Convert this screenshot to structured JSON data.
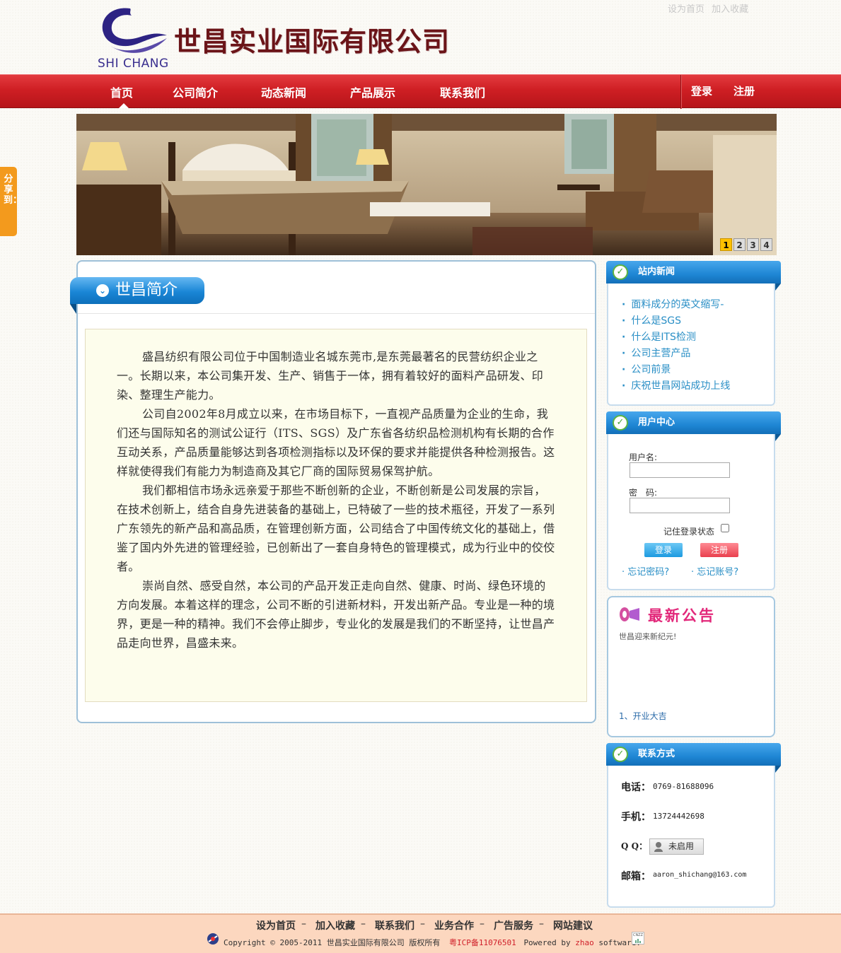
{
  "colors": {
    "nav_red": "#cf1f24",
    "brand_blue": "#1a86d6",
    "link_blue": "#2a8fc6",
    "share_orange": "#f39a1d",
    "notice_pink": "#e2287a"
  },
  "top_links": [
    "设为首页",
    "加入收藏"
  ],
  "header": {
    "company_name": "世昌实业国际有限公司",
    "logo_text": "SHI CHANG"
  },
  "nav": {
    "items": [
      "首页",
      "公司简介",
      "动态新闻",
      "产品展示",
      "联系我们"
    ],
    "login": "登录",
    "register": "注册"
  },
  "share": {
    "label": "分享到："
  },
  "banner": {
    "dots": [
      "1",
      "2",
      "3",
      "4"
    ],
    "active_dot": "1"
  },
  "intro": {
    "title": "世昌简介",
    "paragraphs": [
      "盛昌纺织有限公司位于中国制造业名城东莞市,是东莞最著名的民营纺织企业之一。长期以来，本公司集开发、生产、销售于一体，拥有着较好的面料产品研发、印染、整理生产能力。",
      "公司自2002年8月成立以来，在市场目标下，一直视产品质量为企业的生命，我们还与国际知名的测试公证行（ITS、SGS）及广东省各纺织品检测机构有长期的合作互动关系，产品质量能够达到各项检测指标以及环保的要求并能提供各种检测报告。这样就使得我们有能力为制造商及其它厂商的国际贸易保驾护航。",
      "我们都相信市场永远亲爱于那些不断创新的企业，不断创新是公司发展的宗旨，在技术创新上，结合自身先进装备的基础上，已特破了一些的技术瓶径，开发了一系列广东领先的新产品和高品质，在管理创新方面，公司结合了中国传统文化的基础上，借鉴了国内外先进的管理经验，已创新出了一套自身特色的管理模式，成为行业中的佼佼者。",
      "崇尚自然、感受自然，本公司的产品开发正走向自然、健康、时尚、绿色环境的方向发展。本着这样的理念，公司不断的引进新材料，开发出新产品。专业是一种的境界，更是一种的精神。我们不会停止脚步，专业化的发展是我们的不断坚持，让世昌产品走向世界，昌盛未来。"
    ]
  },
  "site_news": {
    "title": "站内新闻",
    "items": [
      "面料成分的英文缩写-",
      "什么是SGS",
      "什么是ITS检测",
      "公司主营产品",
      "公司前景",
      "庆祝世昌网站成功上线"
    ]
  },
  "user_center": {
    "title": "用户中心",
    "username_label": "用户名:",
    "password_label": "密　码:",
    "remember_label": "记住登录状态",
    "login_button": "登录",
    "register_button": "注册",
    "forgot_password": "忘记密码?",
    "forgot_account": "忘记账号?"
  },
  "notice": {
    "title": "最新公告",
    "text": "世昌迎来新纪元!",
    "item": "1、开业大吉"
  },
  "contact": {
    "title": "联系方式",
    "phone_label": "电话：",
    "phone": "0769-81688096",
    "mobile_label": "手机：",
    "mobile": "13724442698",
    "qq_label": "Q Q：",
    "qq_button": "未启用",
    "email_label": "邮箱：",
    "email": "aaron_shichang@163.com"
  },
  "footer": {
    "links": [
      "设为首页",
      "加入收藏",
      "联系我们",
      "业务合作",
      "广告服务",
      "网站建议"
    ],
    "copyright_prefix": "Copyright © 2005-2011 世昌实业国际有限公司 版权所有",
    "icp": "粤ICP备11076501",
    "powered_prefix": "Powered by",
    "powered_name": "zhao",
    "powered_suffix": "software.",
    "cnzz_label": "CNZZ"
  }
}
